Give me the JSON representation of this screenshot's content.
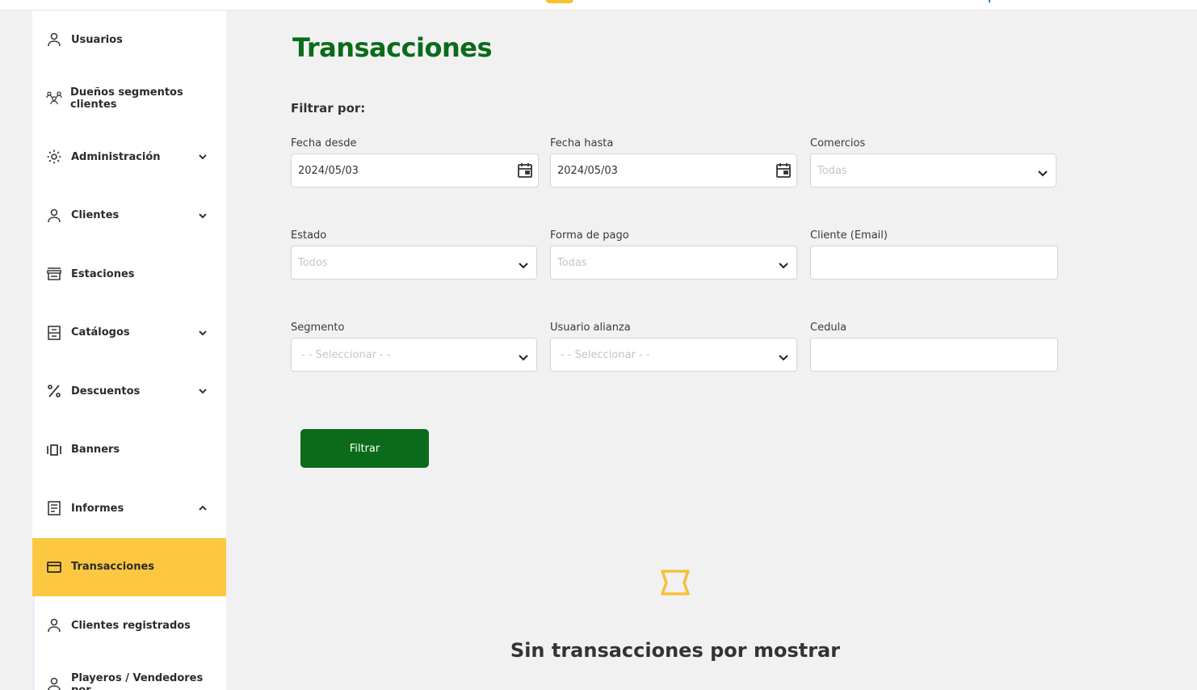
{
  "sidebar": {
    "items": [
      {
        "label": "Usuarios",
        "icon": "user-icon"
      },
      {
        "label": "Dueños segmentos clientes",
        "icon": "group-icon"
      },
      {
        "label": "Administración",
        "icon": "gear-icon",
        "chevron": "down"
      },
      {
        "label": "Clientes",
        "icon": "user-icon",
        "chevron": "down"
      },
      {
        "label": "Estaciones",
        "icon": "store-icon"
      },
      {
        "label": "Catálogos",
        "icon": "catalog-icon",
        "chevron": "down"
      },
      {
        "label": "Descuentos",
        "icon": "percent-icon",
        "chevron": "down"
      },
      {
        "label": "Banners",
        "icon": "carousel-icon"
      },
      {
        "label": "Informes",
        "icon": "report-icon",
        "chevron": "up"
      },
      {
        "label": "Transacciones",
        "icon": "credit-card-icon",
        "active": true
      },
      {
        "label": "Clientes registrados",
        "icon": "user-icon"
      },
      {
        "label": "Playeros / Vendedores por",
        "icon": "user-icon"
      }
    ]
  },
  "page": {
    "title": "Transacciones",
    "filter_title": "Filtrar por:"
  },
  "filters": {
    "fecha_desde": {
      "label": "Fecha desde",
      "value": "2024/05/03"
    },
    "fecha_hasta": {
      "label": "Fecha hasta",
      "value": "2024/05/03"
    },
    "comercios": {
      "label": "Comercios",
      "placeholder": "Todas"
    },
    "estado": {
      "label": "Estado",
      "placeholder": "Todos"
    },
    "forma_pago": {
      "label": "Forma de pago",
      "placeholder": "Todas"
    },
    "cliente_email": {
      "label": "Cliente (Email)",
      "value": ""
    },
    "segmento": {
      "label": "Segmento",
      "placeholder": "- - Seleccionar - -"
    },
    "usuario_alianza": {
      "label": "Usuario alianza",
      "placeholder": "- - Seleccionar - -"
    },
    "cedula": {
      "label": "Cedula",
      "value": ""
    }
  },
  "actions": {
    "filter_label": "Filtrar"
  },
  "empty_state": {
    "icon": "ticket-icon",
    "text": "Sin transacciones por mostrar"
  },
  "colors": {
    "brand_green": "#0b6b1b",
    "accent_yellow": "#fcc741",
    "background": "#f1f1f1"
  }
}
